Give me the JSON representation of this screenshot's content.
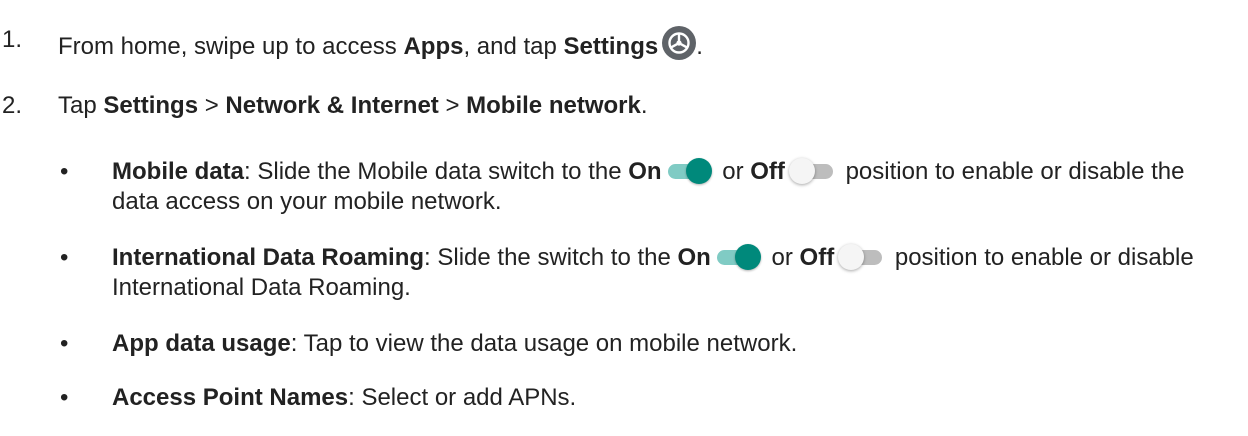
{
  "steps": [
    {
      "num": "1.",
      "pre": "From home, swipe up to access ",
      "b1": "Apps",
      "mid": ", and tap ",
      "b2": "Settings",
      "post": ".",
      "icon": "settings-gear-icon"
    },
    {
      "num": "2.",
      "pre": "Tap ",
      "b1": "Settings",
      "sep1": " > ",
      "b2": "Network & Internet",
      "sep2": " > ",
      "b3": "Mobile network",
      "post": "."
    }
  ],
  "bullets": [
    {
      "dot": "•",
      "title": "Mobile data",
      "pre": ": Slide the Mobile data switch to the ",
      "on": "On",
      "or": " or ",
      "off": "Off",
      "post": " position to enable or disable the data access on your mobile network."
    },
    {
      "dot": "•",
      "title": "International Data Roaming",
      "pre": ": Slide the switch to the ",
      "on": "On",
      "or": " or ",
      "off": "Off",
      "post": " position to enable or disable International Data Roaming."
    },
    {
      "dot": "•",
      "title": "App data usage",
      "text": ": Tap to view the data usage on mobile network."
    },
    {
      "dot": "•",
      "title": "Access Point Names",
      "text": ": Select or add APNs."
    }
  ],
  "colors": {
    "text": "#222222",
    "toggle_on_knob": "#00897b",
    "toggle_on_track": "#80cbc4",
    "toggle_off_knob": "#f5f5f5",
    "toggle_off_track": "#bdbdbd",
    "gear_bg": "#5f6368"
  }
}
